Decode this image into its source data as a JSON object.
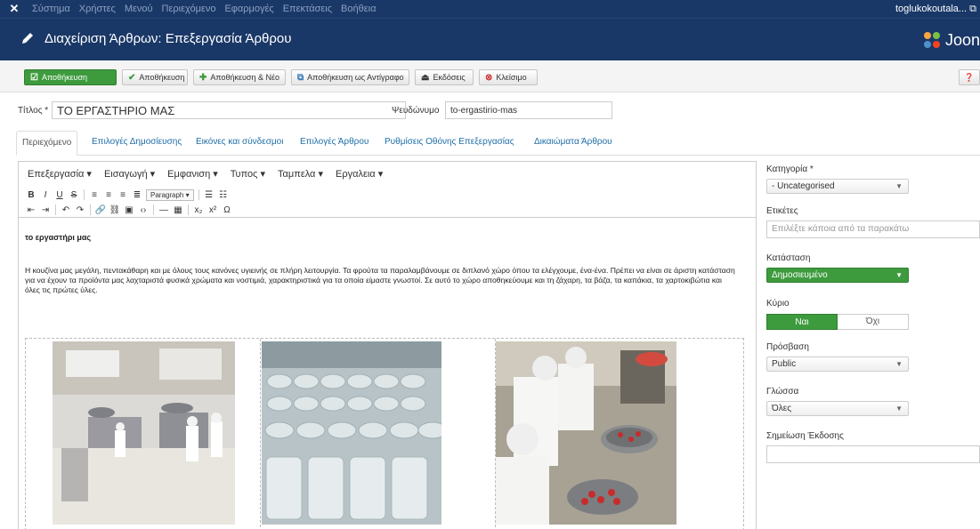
{
  "topbar": {
    "menu": [
      "Σύστημα",
      "Χρήστες",
      "Μενού",
      "Περιεχόμενο",
      "Εφαρμογές",
      "Επεκτάσεις",
      "Βοήθεια"
    ],
    "user": "toglukokoutala... ⧉"
  },
  "header": {
    "title": "Διαχείριση Άρθρων: Επεξεργασία Άρθρου",
    "brand": "Joon"
  },
  "toolbar": {
    "save_primary": "Αποθήκευση",
    "save": "Αποθήκευση",
    "save_new": "Αποθήκευση & Νέο",
    "save_copy": "Αποθήκευση ως Αντίγραφο",
    "versions": "Εκδόσεις",
    "close": "Κλείσιμο",
    "help": "❓"
  },
  "form": {
    "title_label": "Τίτλος *",
    "title_value": "ΤΟ ΕΡΓΑΣΤΗΡΙΟ ΜΑΣ",
    "alias_label": "Ψευδώνυμο",
    "alias_value": "to-ergastirio-mas"
  },
  "tabs": [
    "Περιεχόμενο",
    "Επιλογές Δημοσίευσης",
    "Εικόνες και σύνδεσμοι",
    "Επιλογές Άρθρου",
    "Ρυθμίσεις Οθόνης Επεξεργασίας",
    "Δικαιώματα Άρθρου"
  ],
  "editor": {
    "menus": [
      "Επεξεργασία ▾",
      "Εισαγωγή ▾",
      "Εμφανιση ▾",
      "Τυπος ▾",
      "Ταμπελα ▾",
      "Εργαλεια ▾"
    ],
    "format_select": "Paragraph",
    "heading": "το εργαστήρι μας",
    "paragraph": "Η κουζίνα μας μεγάλη, πεντακάθαρη και με όλους τους κανόνες υγιεινής σε πλήρη λειτουργία. Τα φρούτα τα παραλαμβάνουμε σε διπλανό χώρο όπου τα ελέγχουμε, ένα-ένα. Πρέπει να είναι σε άριστη κατάσταση για να έχουν τα προϊόντα μας λαχταριστά φυσικά χρώματα και νοστιμιά, χαρακτηριστικά για τα οποία είμαστε γνωστοί. Σε αυτό το χώρο αποθηκεύουμε και τη ζάχαρη, τα βάζα, τα καπάκια, τα χαρτοκιβώτια και όλες τις πρώτες ύλες."
  },
  "sidebar": {
    "category_label": "Κατηγορία *",
    "category_value": "- Uncategorised",
    "tags_label": "Ετικέτες",
    "tags_placeholder": "Επιλέξτε κάποια από τα παρακάτω",
    "status_label": "Κατάσταση",
    "status_value": "Δημοσιευμένο",
    "featured_label": "Κύριο",
    "featured_yes": "Ναι",
    "featured_no": "Όχι",
    "access_label": "Πρόσβαση",
    "access_value": "Public",
    "language_label": "Γλώσσα",
    "language_value": "Όλες",
    "version_note_label": "Σημείωση Έκδοσης"
  },
  "colors": {
    "navy": "#1a3867",
    "green": "#3d9b3d",
    "link": "#1e6ea7"
  }
}
